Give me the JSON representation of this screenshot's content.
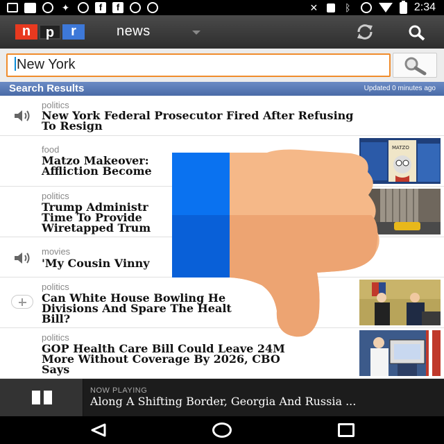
{
  "status_bar": {
    "time": "2:34",
    "icons": [
      "dots-icon",
      "square-icon",
      "timer-icon",
      "wrench-icon",
      "smiley-icon",
      "facebook-icon",
      "facebook-icon",
      "smiley-icon",
      "info-icon",
      "nfc-icon",
      "lock-icon",
      "bluetooth-icon",
      "alarm-icon",
      "wifi-icon",
      "battery-icon"
    ]
  },
  "app_bar": {
    "logo": [
      "n",
      "p",
      "r"
    ],
    "section": "news",
    "icons": [
      "dropdown-icon",
      "refresh-icon",
      "search-icon"
    ]
  },
  "search": {
    "value": "New York"
  },
  "results_header": {
    "title": "Search Results",
    "updated": "Updated 0 minutes ago"
  },
  "results": [
    {
      "category": "politics",
      "headline_lines": [
        "New York Federal Prosecutor Fired After Refusing",
        "To Resign"
      ],
      "icon": "speaker-icon",
      "thumb": null
    },
    {
      "category": "food",
      "headline_lines": [
        "Matzo Makeover:",
        "Affliction Become"
      ],
      "icon": null,
      "thumb": "matzo-thumb"
    },
    {
      "category": "politics",
      "headline_lines": [
        "Trump Administr",
        "Time To Provide",
        "Wiretapped Trum"
      ],
      "icon": null,
      "thumb": "tower-thumb"
    },
    {
      "category": "movies",
      "headline_lines": [
        "'My Cousin Vinny"
      ],
      "icon": "speaker-icon",
      "thumb": null
    },
    {
      "category": "politics",
      "headline_lines": [
        "Can White House Bowling He",
        "Divisions And Spare The Healt",
        "Bill?"
      ],
      "icon": "add-icon",
      "thumb": "white-house-thumb"
    },
    {
      "category": "politics",
      "headline_lines": [
        "GOP Health Care Bill Could Leave 24M",
        "More Without Coverage By 2026, CBO",
        "Says"
      ],
      "icon": null,
      "thumb": "podium-thumb"
    }
  ],
  "now_playing": {
    "label": "NOW PLAYING",
    "title": "Along A Shifting Border, Georgia And Russia ..."
  },
  "colors": {
    "search_border": "#f08c2c",
    "results_bar": "#5a7bb8",
    "npr_n": "#e8391f",
    "npr_r": "#3d78d8",
    "overlay_cuff": "#0a6fe8",
    "overlay_hand": "#f4b07a"
  }
}
